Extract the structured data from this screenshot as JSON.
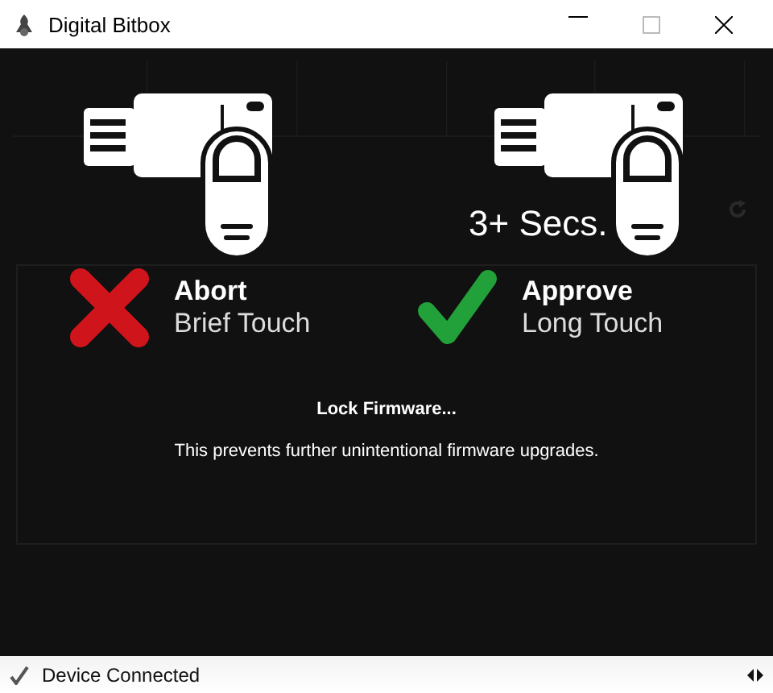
{
  "window": {
    "title": "Digital Bitbox"
  },
  "dialog": {
    "long_press_hint": "3+ Secs.",
    "actions": [
      {
        "kind": "abort",
        "title": "Abort",
        "subtitle": "Brief Touch"
      },
      {
        "kind": "approve",
        "title": "Approve",
        "subtitle": "Long Touch"
      }
    ],
    "heading": "Lock Firmware...",
    "message": "This prevents further unintentional firmware upgrades."
  },
  "status_bar": {
    "text": "Device Connected"
  }
}
